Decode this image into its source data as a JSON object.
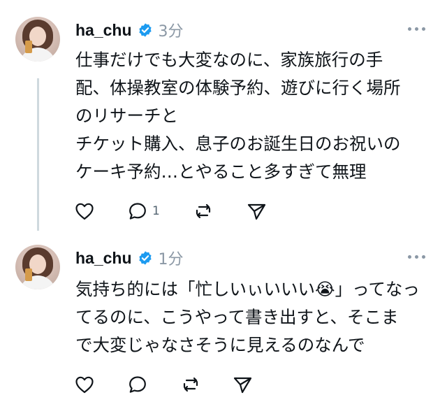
{
  "posts": [
    {
      "username": "ha_chu",
      "time": "3分",
      "text": "仕事だけでも大変なのに、家族旅行の手\n配、体操教室の体験予約、遊びに行く場所\nのリサーチと\nチケット購入、息子のお誕生日のお祝いの\nケーキ予約…とやること多すぎて無理",
      "reply_count": "1"
    },
    {
      "username": "ha_chu",
      "time": "1分",
      "text": "気持ち的には「忙しいぃいいい😭」ってなっ\nてるのに、こうやって書き出すと、そこま\nで大変じゃなさそうに見えるのなんで",
      "reply_count": ""
    }
  ],
  "colors": {
    "text": "#0f1419",
    "meta": "#8b98a5",
    "verified": "#1d9bf0",
    "icon": "#536471",
    "thread_line": "#cfd9de"
  }
}
